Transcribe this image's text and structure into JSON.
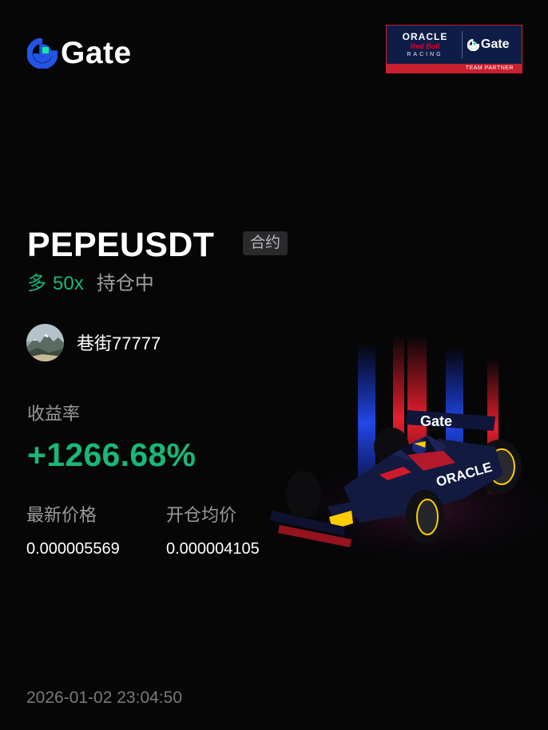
{
  "brand": {
    "name": "Gate",
    "logo_icon": "gate-logo-icon",
    "accent_color": "#2354e6"
  },
  "partner_badge": {
    "oracle": "ORACLE",
    "red_bull": "Red Bull",
    "racing": "RACING",
    "gate": "Gate",
    "footer": "TEAM PARTNER"
  },
  "position": {
    "pair": "PEPEUSDT",
    "contract_tag": "合约",
    "direction": "多",
    "leverage": "50x",
    "status": "持仓中"
  },
  "user": {
    "avatar_icon": "user-avatar-mountain",
    "name": "巷街77777"
  },
  "roi": {
    "label": "收益率",
    "value": "+1266.68%",
    "color": "#19b877"
  },
  "prices": {
    "latest_label": "最新价格",
    "latest_value": "0.000005569",
    "entry_label": "开仓均价",
    "entry_value": "0.000004105"
  },
  "timestamp": "2026-01-02 23:04:50",
  "illustration": {
    "icon": "red-bull-f1-car-illustration",
    "car_wing_text": "Gate",
    "sidepod_text": "ORACLE"
  }
}
